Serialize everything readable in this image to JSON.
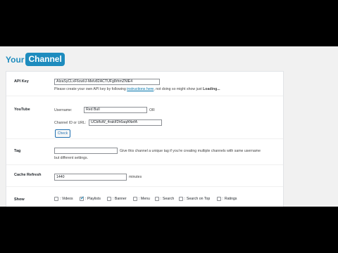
{
  "brand": {
    "your": "Your",
    "channel": "Channel",
    "accent": "#1e8cbe"
  },
  "api_key": {
    "label": "API Key",
    "value": "AIzaSyCLxF6cwIiJ-Melv82ACTUFg8rhmZNlE4",
    "help_prefix": "Please create your own API key by following",
    "help_link": "instructions here",
    "help_suffix": ", not doing so might show just",
    "help_bold": "Loading..."
  },
  "youtube": {
    "label": "YouTube",
    "username_label": "Username:",
    "username_value": "Red Bull",
    "or_text": "OR",
    "channel_label": "Channel ID or URL:",
    "channel_value": "UCblfuW_4rakIf2h6aqANefA",
    "check_button": "Check"
  },
  "tag": {
    "label": "Tag",
    "value": "",
    "help_line1": "Give this channel a unique tag if you're creating multiple channels with same username",
    "help_line2": "but different settings."
  },
  "cache": {
    "label": "Cache Refresh",
    "value": "1440",
    "unit": "minutes"
  },
  "show": {
    "label": "Show",
    "options": [
      {
        "label": ": Videos",
        "checked": false
      },
      {
        "label": ": Playlists",
        "checked": true
      },
      {
        "label": ": Banner",
        "checked": false
      },
      {
        "label": ": Menu",
        "checked": false
      },
      {
        "label": ": Search",
        "checked": false
      },
      {
        "label": ": Search on Top",
        "checked": false
      },
      {
        "label": ": Ratings",
        "checked": false
      }
    ]
  }
}
